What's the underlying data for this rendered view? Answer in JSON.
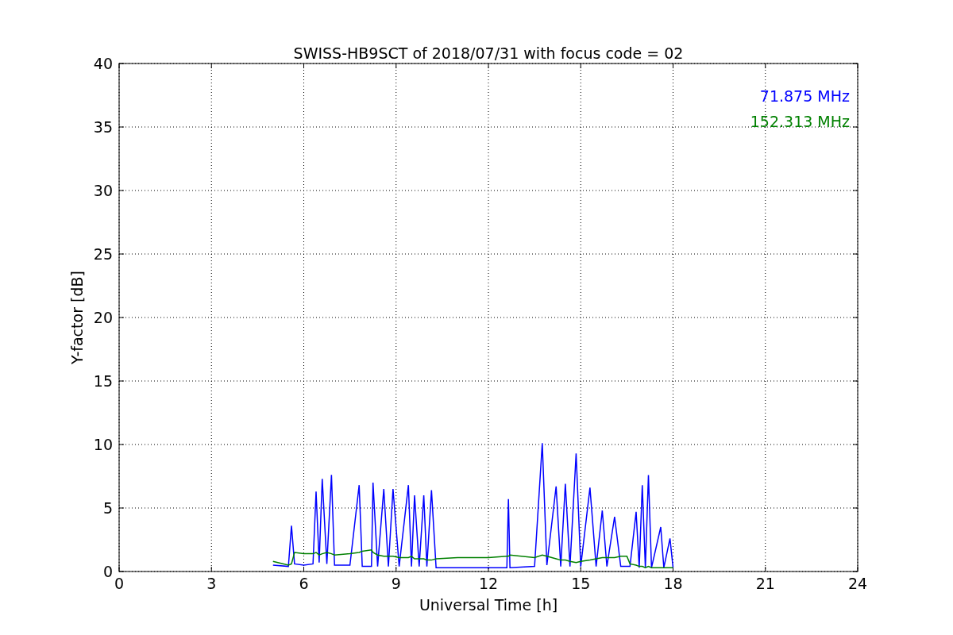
{
  "figure": {
    "chart_data": {
      "type": "line",
      "title": "SWISS-HB9SCT of 2018/07/31 with focus code = 02",
      "xlabel": "Universal Time [h]",
      "ylabel": "Y-factor [dB]",
      "x": [
        5.0,
        5.5,
        5.6,
        5.7,
        6.0,
        6.3,
        6.4,
        6.5,
        6.6,
        6.75,
        6.9,
        7.0,
        7.5,
        7.8,
        7.9,
        8.2,
        8.25,
        8.4,
        8.6,
        8.75,
        8.9,
        9.1,
        9.4,
        9.5,
        9.6,
        9.75,
        9.9,
        10.0,
        10.15,
        10.3,
        11.0,
        12.0,
        12.6,
        12.65,
        12.7,
        13.5,
        13.75,
        13.9,
        14.2,
        14.35,
        14.5,
        14.65,
        14.85,
        15.0,
        15.3,
        15.5,
        15.7,
        15.85,
        16.1,
        16.3,
        16.5,
        16.6,
        16.8,
        16.9,
        17.0,
        17.1,
        17.2,
        17.3,
        17.6,
        17.7,
        17.9,
        18.0
      ],
      "series": [
        {
          "name": "71.875 MHz",
          "color": "#0000ff",
          "values": [
            0.5,
            0.4,
            3.6,
            0.6,
            0.5,
            0.6,
            6.3,
            0.7,
            7.3,
            0.6,
            7.6,
            0.5,
            0.5,
            6.8,
            0.4,
            0.4,
            7.0,
            0.4,
            6.5,
            0.4,
            6.5,
            0.4,
            6.8,
            0.4,
            6.0,
            0.4,
            6.0,
            0.4,
            6.4,
            0.3,
            0.3,
            0.3,
            0.3,
            5.7,
            0.3,
            0.4,
            10.1,
            0.5,
            6.7,
            0.4,
            6.9,
            0.4,
            9.3,
            0.4,
            6.6,
            0.4,
            4.8,
            0.4,
            4.3,
            0.4,
            0.4,
            0.4,
            4.7,
            0.3,
            6.8,
            0.3,
            7.6,
            0.3,
            3.5,
            0.3,
            2.6,
            0.3
          ]
        },
        {
          "name": "152.313 MHz",
          "color": "#008000",
          "values": [
            0.8,
            0.5,
            0.6,
            1.5,
            1.4,
            1.4,
            1.5,
            1.3,
            1.4,
            1.5,
            1.4,
            1.3,
            1.4,
            1.5,
            1.6,
            1.7,
            1.5,
            1.3,
            1.2,
            1.2,
            1.2,
            1.1,
            1.1,
            1.2,
            1.0,
            1.0,
            1.0,
            0.9,
            0.9,
            1.0,
            1.1,
            1.1,
            1.2,
            1.2,
            1.3,
            1.1,
            1.3,
            1.2,
            1.0,
            0.9,
            0.9,
            0.8,
            0.7,
            0.8,
            0.9,
            1.0,
            1.1,
            1.1,
            1.1,
            1.2,
            1.2,
            0.6,
            0.5,
            0.4,
            0.4,
            0.3,
            0.4,
            0.3,
            0.3,
            0.3,
            0.3,
            0.3
          ]
        }
      ],
      "grid": true,
      "xlim": [
        0,
        24
      ],
      "ylim": [
        0,
        40
      ],
      "xticks": [
        0,
        3,
        6,
        9,
        12,
        15,
        18,
        21,
        24
      ],
      "yticks": [
        0,
        5,
        10,
        15,
        20,
        25,
        30,
        35,
        40
      ]
    }
  }
}
